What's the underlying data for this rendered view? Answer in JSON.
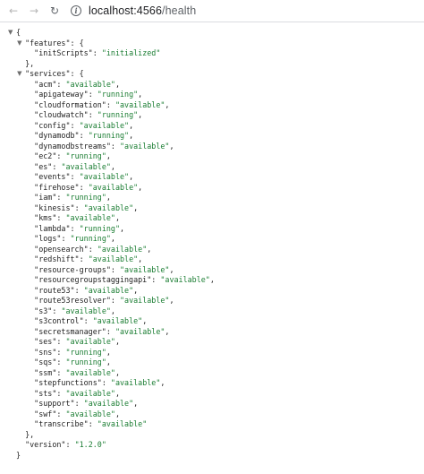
{
  "browser": {
    "url_host": "localhost:4566",
    "url_path": "/health"
  },
  "json": {
    "features_key": "features",
    "features": [
      {
        "key": "initScripts",
        "value": "initialized"
      }
    ],
    "services_key": "services",
    "services": [
      {
        "key": "acm",
        "value": "available"
      },
      {
        "key": "apigateway",
        "value": "running"
      },
      {
        "key": "cloudformation",
        "value": "available"
      },
      {
        "key": "cloudwatch",
        "value": "running"
      },
      {
        "key": "config",
        "value": "available"
      },
      {
        "key": "dynamodb",
        "value": "running"
      },
      {
        "key": "dynamodbstreams",
        "value": "available"
      },
      {
        "key": "ec2",
        "value": "running"
      },
      {
        "key": "es",
        "value": "available"
      },
      {
        "key": "events",
        "value": "available"
      },
      {
        "key": "firehose",
        "value": "available"
      },
      {
        "key": "iam",
        "value": "running"
      },
      {
        "key": "kinesis",
        "value": "available"
      },
      {
        "key": "kms",
        "value": "available"
      },
      {
        "key": "lambda",
        "value": "running"
      },
      {
        "key": "logs",
        "value": "running"
      },
      {
        "key": "opensearch",
        "value": "available"
      },
      {
        "key": "redshift",
        "value": "available"
      },
      {
        "key": "resource-groups",
        "value": "available"
      },
      {
        "key": "resourcegroupstaggingapi",
        "value": "available"
      },
      {
        "key": "route53",
        "value": "available"
      },
      {
        "key": "route53resolver",
        "value": "available"
      },
      {
        "key": "s3",
        "value": "available"
      },
      {
        "key": "s3control",
        "value": "available"
      },
      {
        "key": "secretsmanager",
        "value": "available"
      },
      {
        "key": "ses",
        "value": "available"
      },
      {
        "key": "sns",
        "value": "running"
      },
      {
        "key": "sqs",
        "value": "running"
      },
      {
        "key": "ssm",
        "value": "available"
      },
      {
        "key": "stepfunctions",
        "value": "available"
      },
      {
        "key": "sts",
        "value": "available"
      },
      {
        "key": "support",
        "value": "available"
      },
      {
        "key": "swf",
        "value": "available"
      },
      {
        "key": "transcribe",
        "value": "available"
      }
    ],
    "version_key": "version",
    "version": "1.2.0"
  },
  "colors": {
    "string": "#1a7d32",
    "text": "#1f1f1f"
  },
  "icons": {
    "back": "arrow-left-icon",
    "forward": "arrow-right-icon",
    "reload": "reload-icon",
    "site_info": "info-icon",
    "toggle": "triangle-down-icon"
  }
}
